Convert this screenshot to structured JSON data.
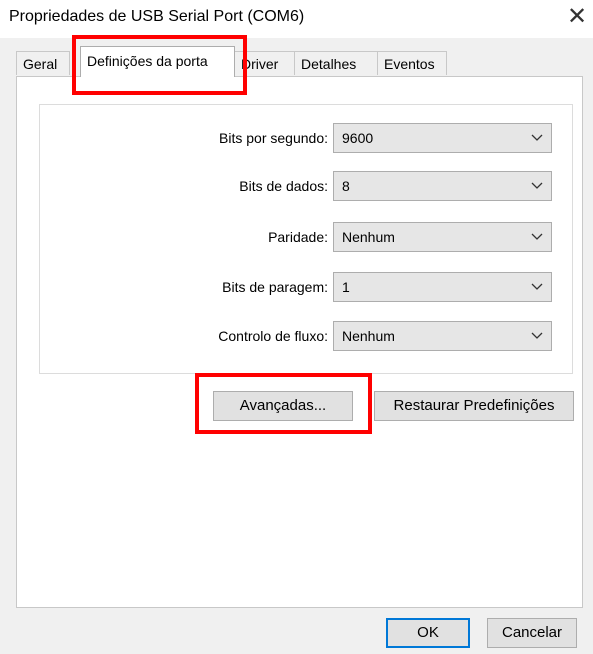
{
  "window": {
    "title": "Propriedades de USB Serial Port (COM6)",
    "close_label": "✕"
  },
  "tabs": [
    {
      "label": "Geral"
    },
    {
      "label": "Definições da porta"
    },
    {
      "label": "Driver"
    },
    {
      "label": "Detalhes"
    },
    {
      "label": "Eventos"
    }
  ],
  "settings": [
    {
      "label": "Bits por segundo:",
      "value": "9600"
    },
    {
      "label": "Bits de dados:",
      "value": "8"
    },
    {
      "label": "Paridade:",
      "value": "Nenhum"
    },
    {
      "label": "Bits de paragem:",
      "value": "1"
    },
    {
      "label": "Controlo de fluxo:",
      "value": "Nenhum"
    }
  ],
  "buttons": {
    "advanced": "Avançadas...",
    "restore": "Restaurar Predefinições",
    "ok": "OK",
    "cancel": "Cancelar"
  },
  "highlight_color": "#ff0000",
  "accent_color": "#0078d7"
}
